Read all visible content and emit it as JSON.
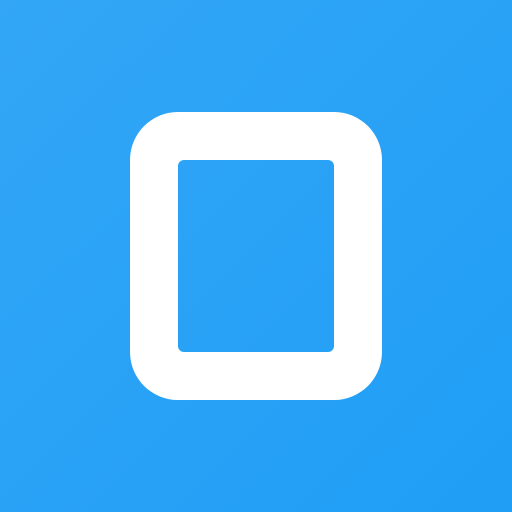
{
  "icon": {
    "name": "rectangle-outline-icon",
    "background_color_start": "#33a6f6",
    "background_color_end": "#1f9ef6",
    "glyph_color": "#ffffff"
  }
}
